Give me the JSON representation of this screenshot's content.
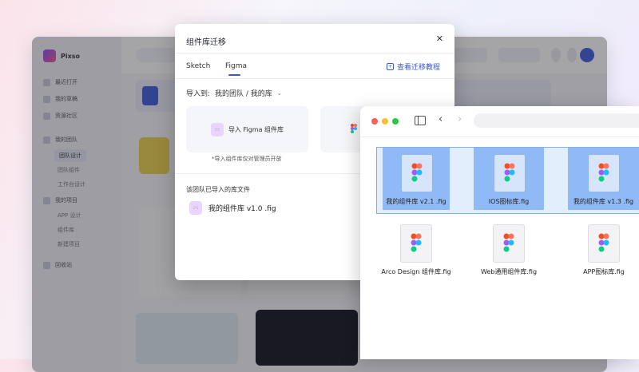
{
  "background_app": {
    "app_name": "Pixso",
    "sidebar_items": [
      "最近打开",
      "我的草稿",
      "资源社区",
      "我的团队",
      "团队设计",
      "团队组件",
      "工作台设计",
      "我的项目",
      "APP 设计",
      "组件库",
      "新建项目",
      "回收站"
    ]
  },
  "dialog": {
    "title": "组件库迁移",
    "close_icon": "close-icon",
    "tabs": [
      {
        "label": "Sketch",
        "active": false
      },
      {
        "label": "Figma",
        "active": true
      }
    ],
    "tutorial_link": "查看迁移教程",
    "import_label": "导入到:",
    "import_path": "我的团队 / 我的库",
    "import_card_label": "导入 Figma 组件库",
    "note": "*导入组件库仅对管理员开放",
    "imported_section": "该团队已导入的库文件",
    "imported_files": [
      "我的组件库 v1.0 .fig"
    ],
    "accent_color": "#3a57d8"
  },
  "finder": {
    "traffic_lights": [
      "#ff5f57",
      "#febc2e",
      "#28c840"
    ],
    "selected_files": [
      {
        "name": "我的组件库 v2.1 .fig"
      },
      {
        "name": "IOS图标库.fig"
      },
      {
        "name": "我的组件库 v1.3 .fig"
      }
    ],
    "files": [
      {
        "name": "Arco Design 组件库.fig"
      },
      {
        "name": "Web通用组件库.fig"
      },
      {
        "name": "APP图标库.fig"
      }
    ],
    "selection_color": "#4a8ff0"
  }
}
